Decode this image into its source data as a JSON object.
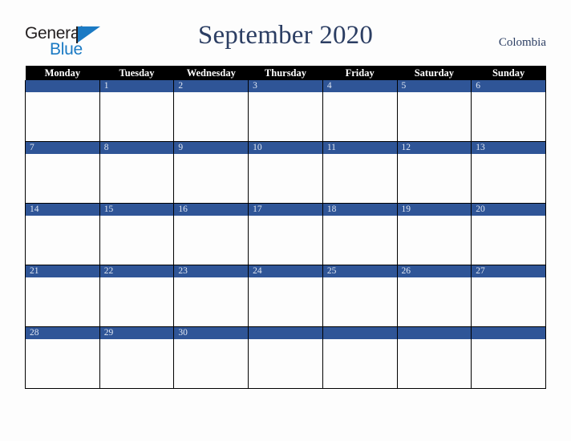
{
  "brand": {
    "logo_top_text": "General",
    "logo_bottom_text": "Blue",
    "triangle_icon": "triangle-right-icon",
    "accent_color": "#1b7ac4",
    "dark_color": "#231f20"
  },
  "header": {
    "title": "September 2020",
    "region": "Colombia",
    "title_color": "#2c3e63"
  },
  "calendar": {
    "header_background": "#000000",
    "header_text_color": "#ffffff",
    "day_band_color": "#2f5597",
    "day_number_color": "#dfe6f2",
    "weekday_headers": [
      "Monday",
      "Tuesday",
      "Wednesday",
      "Thursday",
      "Friday",
      "Saturday",
      "Sunday"
    ],
    "weeks": [
      [
        "",
        "1",
        "2",
        "3",
        "4",
        "5",
        "6"
      ],
      [
        "7",
        "8",
        "9",
        "10",
        "11",
        "12",
        "13"
      ],
      [
        "14",
        "15",
        "16",
        "17",
        "18",
        "19",
        "20"
      ],
      [
        "21",
        "22",
        "23",
        "24",
        "25",
        "26",
        "27"
      ],
      [
        "28",
        "29",
        "30",
        "",
        "",
        "",
        ""
      ]
    ]
  }
}
